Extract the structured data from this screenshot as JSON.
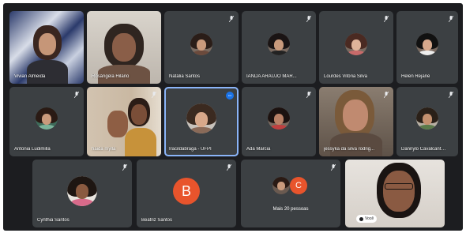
{
  "participants": [
    {
      "name": "Vivian Almeida",
      "type": "video"
    },
    {
      "name": "Rosângela Hilário",
      "type": "video"
    },
    {
      "name": "Natália Santos",
      "type": "avatar"
    },
    {
      "name": "IANDA ARAUJO MAR...",
      "type": "avatar"
    },
    {
      "name": "Lourdes Vitória Silva",
      "type": "avatar"
    },
    {
      "name": "Helen Rejane",
      "type": "avatar"
    },
    {
      "name": "Antonia Ludimilla",
      "type": "avatar"
    },
    {
      "name": "haida mylla",
      "type": "video"
    },
    {
      "name": "Iracildabraga - UFPI",
      "type": "avatar",
      "active": true
    },
    {
      "name": "Ada Márcia",
      "type": "avatar"
    },
    {
      "name": "jessyka da silva rodrig...",
      "type": "video"
    },
    {
      "name": "Dannylo Cavalcante -...",
      "type": "avatar"
    },
    {
      "name": "Cynthia Santos",
      "type": "avatar"
    },
    {
      "name": "Beatriz Santos",
      "type": "letter",
      "letter": "B"
    },
    {
      "name": "Mais 20 pessoas",
      "type": "more",
      "letter": "C"
    },
    {
      "name": "Você",
      "type": "self-video"
    }
  ],
  "colors": {
    "stage_bg": "#1c1d20",
    "tile_bg": "#3c4043",
    "active_border": "#8ab4f8",
    "letter_avatar": "#e8542c"
  }
}
